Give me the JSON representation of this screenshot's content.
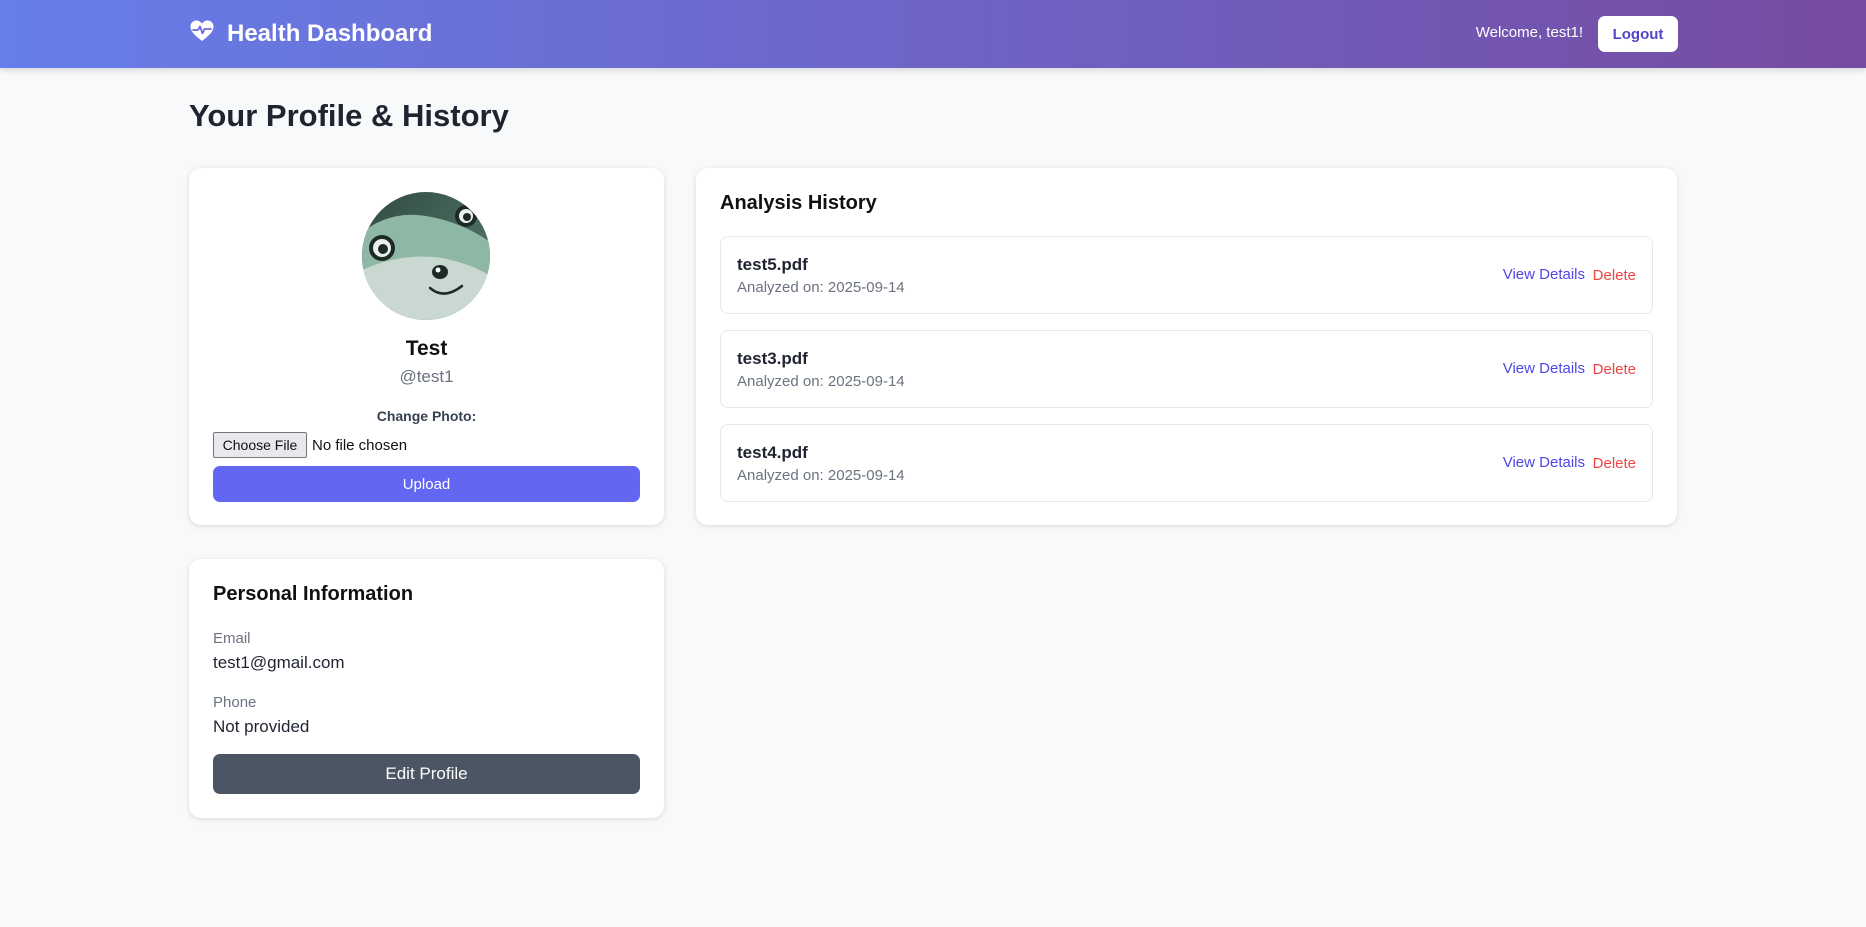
{
  "header": {
    "brand": "Health Dashboard",
    "brand_icon": "heart-pulse-icon",
    "welcome": "Welcome, test1!",
    "logout_label": "Logout",
    "gradient_start": "#667eea",
    "gradient_end": "#764ba2"
  },
  "page": {
    "title": "Your Profile & History"
  },
  "profile": {
    "name": "Test",
    "handle": "@test1",
    "change_photo_label": "Change Photo:",
    "choose_file_label": "Choose File",
    "file_status": "No file chosen",
    "upload_label": "Upload"
  },
  "history": {
    "title": "Analysis History",
    "items": [
      {
        "file": "test5.pdf",
        "date": "Analyzed on: 2025-09-14",
        "view_label": "View Details",
        "delete_label": "Delete"
      },
      {
        "file": "test3.pdf",
        "date": "Analyzed on: 2025-09-14",
        "view_label": "View Details",
        "delete_label": "Delete"
      },
      {
        "file": "test4.pdf",
        "date": "Analyzed on: 2025-09-14",
        "view_label": "View Details",
        "delete_label": "Delete"
      }
    ]
  },
  "personal": {
    "title": "Personal Information",
    "email_label": "Email",
    "email_value": "test1@gmail.com",
    "phone_label": "Phone",
    "phone_value": "Not provided",
    "edit_label": "Edit Profile"
  },
  "colors": {
    "accent": "#6366f1",
    "link": "#4f46e5",
    "danger": "#ef4444",
    "edit_button": "#4b5563"
  }
}
